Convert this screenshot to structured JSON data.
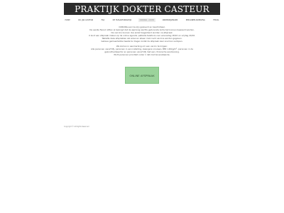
{
  "header": {
    "title": "PRAKTIJK DOKTER CASTEUR"
  },
  "nav": {
    "items": [
      {
        "label": "HOME",
        "active": false
      },
      {
        "label": "DR. JAN CASTEUR",
        "active": false
      },
      {
        "label": "FAQ",
        "active": false
      },
      {
        "label": "DE HUISARTSPRAKTIJK",
        "active": false
      },
      {
        "label": "CORONA - COVID",
        "active": true
      },
      {
        "label": "ONDERWIJZINGEN",
        "active": false
      },
      {
        "label": "PERSONEELSWERVING",
        "active": false
      },
      {
        "label": "TERUG",
        "active": false
      }
    ]
  },
  "content": {
    "paragraph1": [
      "CORONA-vaccins zijn geleverd en beschikbaar.",
      "De eerste fiscum zitten al bezorgd dat de aspireng slechts gedurende korte tijd kunnen bewaard worden.",
      "De vaccins kunnen dus enkel toegediend worden na afspraak.",
      "U kunt een afspraak maken op de online agenda, patiënts telefonis voor woensdag 18/10 en vrijdag 20/10.",
      "Tabletts deze afsprakken zal enkel en alleen met covid vaccins worden gegeven.",
      "Gelieve gemeenteliike teeste te dragen zodat de afspraak zeer snel kan verlopen."
    ],
    "paragraph2": [
      "We komen in aanmerking om een vaccin te krijgen:",
      "Alle personen vanaf 65j, personen in een instelling, zwangere vrouwen, BMI >40kg/m², personen in de",
      "gezondheidssector en personen vanaf 18j met een chronische aandoening.",
      "PLUS personen prioriteit onder 1 dat met bovenstaande."
    ]
  },
  "cta": {
    "label": "ONLINE AFSPRAAK"
  },
  "footer": {
    "copyright": "Copyright © All Rights Reserved"
  }
}
